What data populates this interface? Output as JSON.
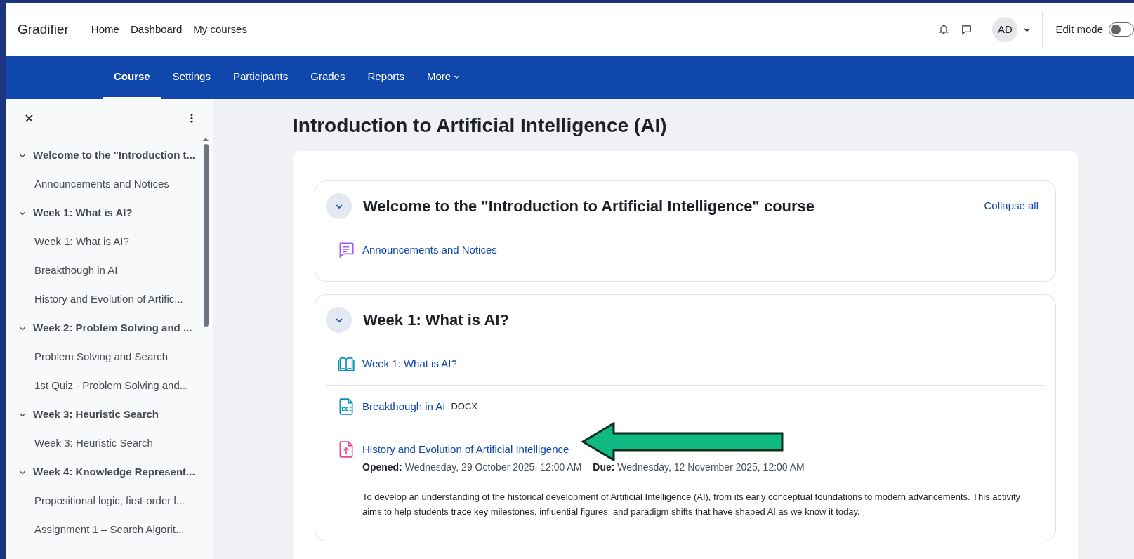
{
  "navbar": {
    "brand": "Gradifier",
    "links": [
      "Home",
      "Dashboard",
      "My courses"
    ],
    "avatar": "AD",
    "edit_mode": {
      "label": "Edit mode",
      "on": false
    }
  },
  "tabs": [
    {
      "label": "Course",
      "selected": true,
      "kind": "link"
    },
    {
      "label": "Settings",
      "selected": false,
      "kind": "link"
    },
    {
      "label": "Participants",
      "selected": false,
      "kind": "link"
    },
    {
      "label": "Grades",
      "selected": false,
      "kind": "link"
    },
    {
      "label": "Reports",
      "selected": false,
      "kind": "link"
    },
    {
      "label": "More",
      "selected": false,
      "kind": "menu"
    }
  ],
  "sidebar": {
    "items": [
      {
        "label": "Welcome to the \"Introduction t...",
        "expanded": true,
        "children": [
          {
            "label": "Announcements and Notices"
          }
        ]
      },
      {
        "label": "Week 1: What is AI?",
        "expanded": true,
        "children": [
          {
            "label": "Week 1: What is AI?"
          },
          {
            "label": "Breakthough in AI"
          },
          {
            "label": "History and Evolution of Artific..."
          }
        ]
      },
      {
        "label": "Week 2: Problem Solving and ...",
        "expanded": true,
        "children": [
          {
            "label": "Problem Solving and Search"
          },
          {
            "label": "1st Quiz - Problem Solving and..."
          }
        ]
      },
      {
        "label": "Week 3: Heuristic Search",
        "expanded": true,
        "children": [
          {
            "label": "Week 3: Heuristic Search"
          }
        ]
      },
      {
        "label": "Week 4: Knowledge Represent...",
        "expanded": true,
        "children": [
          {
            "label": "Propositional logic, first-order l..."
          },
          {
            "label": "Assignment 1 – Search Algorit..."
          }
        ]
      }
    ]
  },
  "page_title": "Introduction to Artificial Intelligence (AI)",
  "collapse_all": "Collapse all",
  "sections": [
    {
      "title": "Welcome to the \"Introduction to Artificial Intelligence\" course",
      "expanded": true,
      "activities": [
        {
          "kind": "forum",
          "name": "Announcements and Notices"
        }
      ]
    },
    {
      "title": "Week 1: What is AI?",
      "expanded": true,
      "activities": [
        {
          "kind": "book",
          "name": "Week 1: What is AI?"
        },
        {
          "kind": "file",
          "name": "Breakthough in AI",
          "badge": "DOCX"
        },
        {
          "kind": "assignment",
          "name": "History and Evolution of Artificial Intelligence",
          "opened_label": "Opened:",
          "opened": "Wednesday, 29 October 2025, 12:00 AM",
          "due_label": "Due:",
          "due": "Wednesday, 12 November 2025, 12:00 AM",
          "description": "To develop an understanding of the historical development of Artificial Intelligence (AI), from its early conceptual foundations to modern advancements. This activity aims to help students trace key milestones, influential figures, and paradigm shifts that have shaped AI as we know it today."
        }
      ]
    }
  ]
}
